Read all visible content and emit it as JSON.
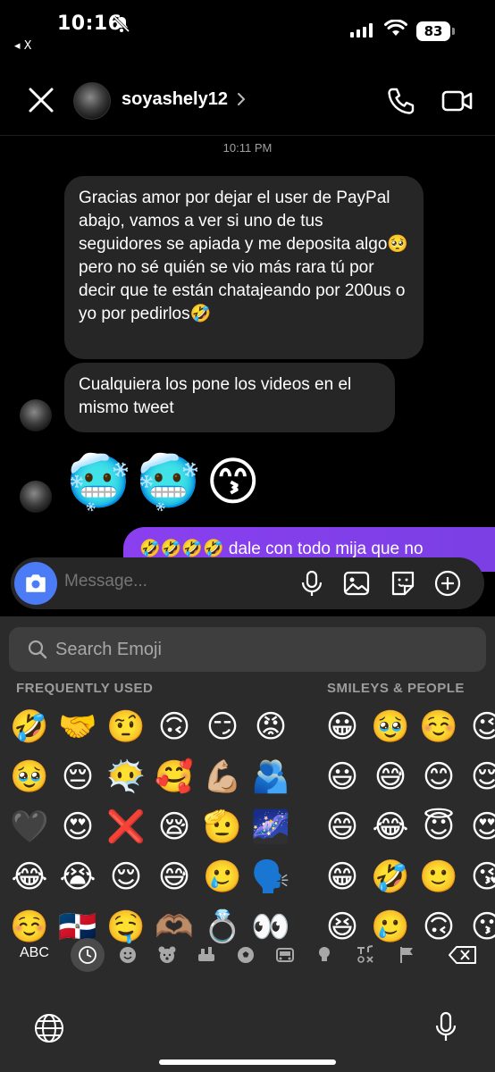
{
  "status_bar": {
    "time": "10:16",
    "back_app": "◂ X",
    "battery": "83"
  },
  "header": {
    "username": "soyashely12"
  },
  "chat": {
    "timestamp": "10:11 PM",
    "messages": [
      "Gracias amor por dejar el user de PayPal abajo, vamos a ver si uno de tus seguidores se apiada y me deposita algo🥺 pero no sé quién se vio más rara tú por decir que te están chatajeando por 200us o yo por pedirlos🤣",
      "Cualquiera los pone los videos en el mismo tweet"
    ],
    "emoji_message": [
      "🥶",
      "🥶",
      "😙"
    ],
    "my_message": "🤣🤣🤣🤣 dale con todo mija que no"
  },
  "composer": {
    "placeholder": "Message..."
  },
  "keyboard": {
    "search_placeholder": "Search Emoji",
    "section_frequent": "FREQUENTLY USED",
    "section_smileys": "SMILEYS & PEOPLE",
    "frequent_rows": [
      [
        "🤣",
        "🤝",
        "🤨",
        "🙃",
        "😏",
        "😡"
      ],
      [
        "🥹",
        "😔",
        "😶‍🌫️",
        "🥰",
        "💪🏼",
        "🫂"
      ],
      [
        "🖤",
        "😍",
        "❌",
        "😪",
        "🫡",
        "🌌"
      ],
      [
        "😂",
        "😭",
        "😌",
        "😅",
        "🥲",
        "🗣️"
      ],
      [
        "☺️",
        "🇩🇴",
        "🤤",
        "🫶🏽",
        "💍",
        "👀"
      ]
    ],
    "smiley_rows": [
      [
        "😀",
        "🥹",
        "☺️",
        "😉"
      ],
      [
        "😃",
        "😅",
        "😊",
        "😌"
      ],
      [
        "😄",
        "😂",
        "😇",
        "😍"
      ],
      [
        "😁",
        "🤣",
        "🙂",
        "😘"
      ],
      [
        "😆",
        "🥲",
        "🙃",
        "😗"
      ]
    ],
    "abc_label": "ABC"
  }
}
